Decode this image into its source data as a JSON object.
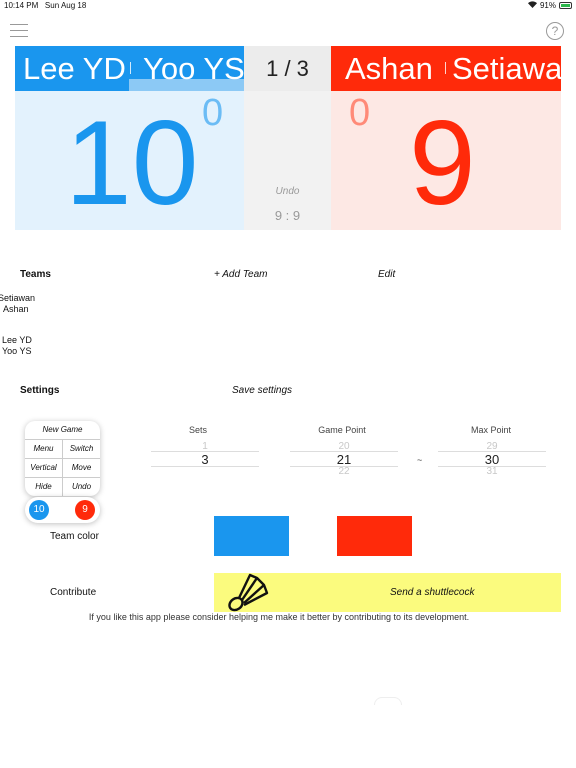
{
  "status_bar": {
    "time": "10:14 PM",
    "date": "Sun Aug 18",
    "battery": "91%"
  },
  "help": {
    "glyph": "?"
  },
  "scoreboard": {
    "left": {
      "players": [
        "Lee YD",
        "Yoo YS"
      ],
      "score": "10",
      "games": "0",
      "color": "#1a96ee"
    },
    "right": {
      "players": [
        "Ashan",
        "Setiawan"
      ],
      "score": "9",
      "games": "0",
      "color": "#ff2a0a"
    },
    "set_indicator": "1 / 3",
    "undo_label": "Undo",
    "previous_score": "9 : 9"
  },
  "teams_section": {
    "title": "Teams",
    "add_label": "+ Add Team",
    "edit_label": "Edit",
    "teams": [
      {
        "player1": "Setiawan",
        "player2": "Ashan"
      },
      {
        "player1": "Lee YD",
        "player2": "Yoo YS"
      }
    ]
  },
  "settings_section": {
    "title": "Settings",
    "save_label": "Save settings"
  },
  "widget_preview": {
    "title": "New Game",
    "buttons": [
      "Menu",
      "Switch",
      "Vertical",
      "Move",
      "Hide",
      "Undo"
    ],
    "left_score": "10",
    "right_score": "9"
  },
  "pickers": {
    "sets": {
      "title": "Sets",
      "above": "1",
      "value": "3",
      "below": ""
    },
    "game_point": {
      "title": "Game Point",
      "above": "20",
      "value": "21",
      "below": "22"
    },
    "separator": "~",
    "max_point": {
      "title": "Max Point",
      "above": "29",
      "value": "30",
      "below": "31"
    }
  },
  "team_color": {
    "label": "Team color",
    "left": "#1a96ee",
    "right": "#ff2a0a"
  },
  "contribute": {
    "label": "Contribute",
    "button_label": "Send a shuttlecock",
    "note": "If you like this app please consider helping me make it better by contributing to its development."
  }
}
